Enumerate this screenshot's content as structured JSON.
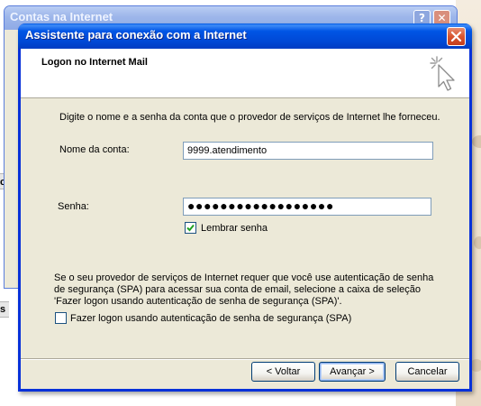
{
  "back_window": {
    "title": "Contas na Internet",
    "help_glyph": "?",
    "close_glyph": "✕"
  },
  "background_labels": {
    "left_1": "c",
    "left_2": "s"
  },
  "dialog": {
    "title": "Assistente para conexão com a Internet",
    "header_title": "Logon no Internet Mail",
    "icon": "wizard-cursor-icon",
    "instruction": "Digite o nome e a senha da conta que o provedor de serviços de Internet lhe forneceu.",
    "account_label": "Nome da conta:",
    "account_value": "9999.atendimento",
    "password_label": "Senha:",
    "password_masked": "●●●●●●●●●●●●●●●●●●",
    "remember_label": "Lembrar senha",
    "remember_checked": true,
    "spa_text_line1": "Se o seu provedor de serviços de Internet requer que você use autenticação de senha",
    "spa_text_line2": "de segurança (SPA) para acessar sua conta de email, selecione a caixa de seleção",
    "spa_text_line3": "'Fazer logon usando autenticação de senha de segurança (SPA)'.",
    "spa_label": "Fazer logon usando autenticação de senha de segurança (SPA)",
    "spa_checked": false,
    "buttons": {
      "back": "< Voltar",
      "next": "Avançar >",
      "cancel": "Cancelar"
    }
  },
  "colors": {
    "titlebar": "#0054e3",
    "dialog_face": "#ece9d8",
    "close_button": "#d8552f"
  }
}
